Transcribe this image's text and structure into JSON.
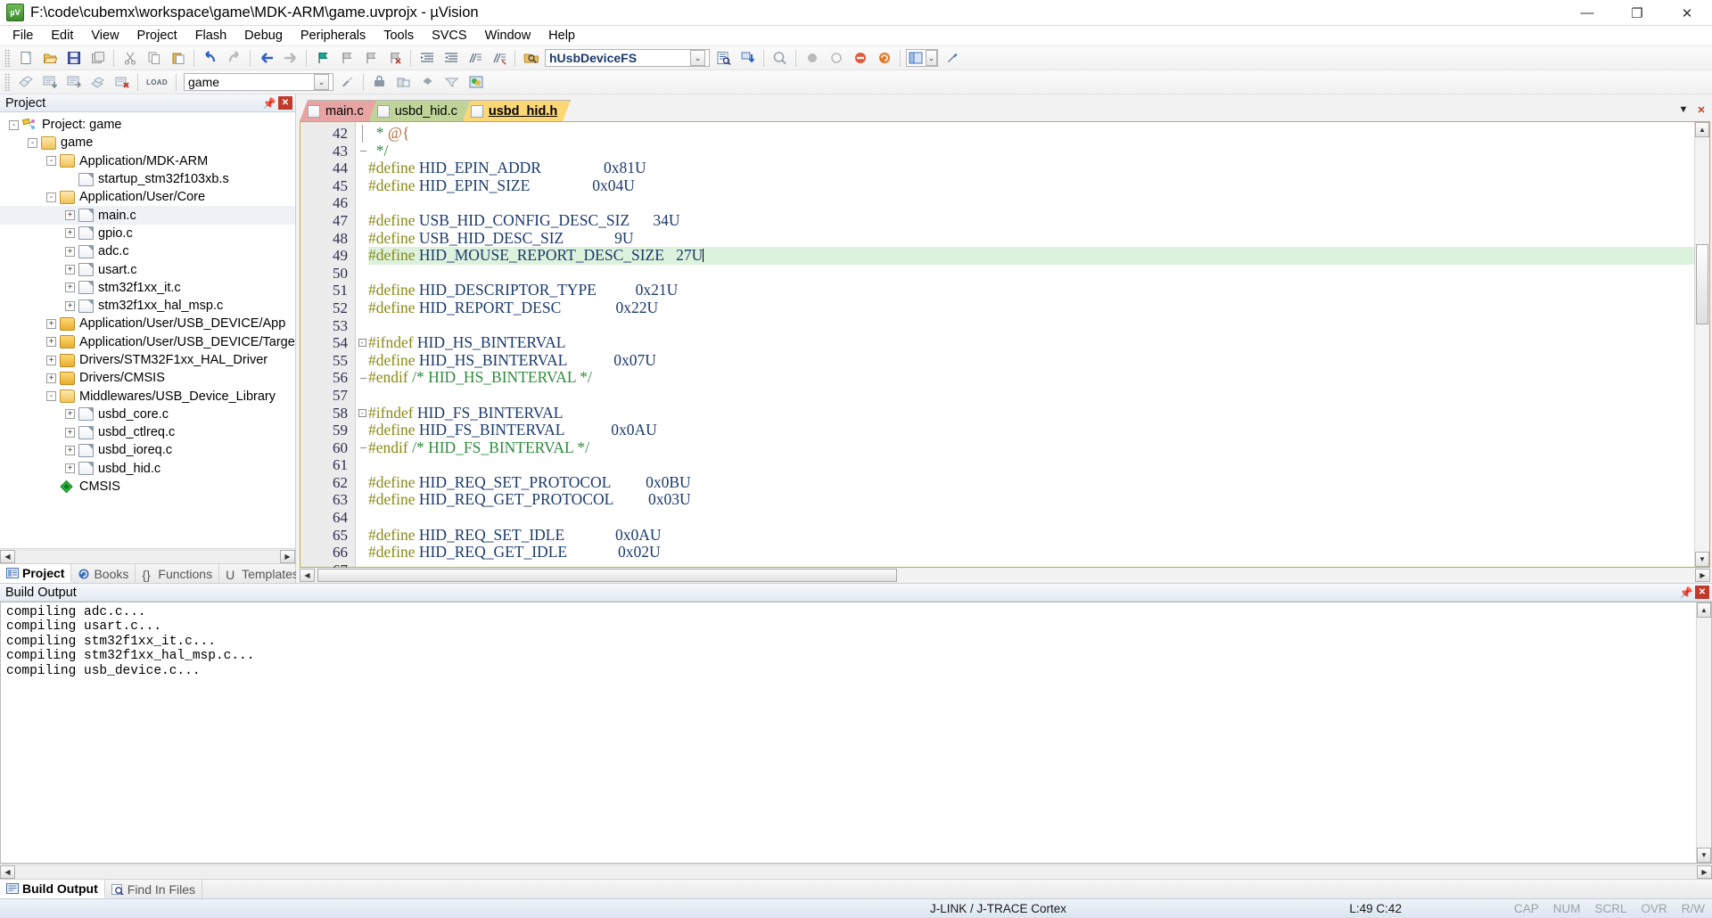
{
  "window": {
    "title": "F:\\code\\cubemx\\workspace\\game\\MDK-ARM\\game.uvprojx - µVision",
    "app_icon": "uvision-icon",
    "minimize": "—",
    "maximize": "❐",
    "close": "✕"
  },
  "menu": [
    "File",
    "Edit",
    "View",
    "Project",
    "Flash",
    "Debug",
    "Peripherals",
    "Tools",
    "SVCS",
    "Window",
    "Help"
  ],
  "toolbar1": {
    "icons": [
      "new-file-icon",
      "open-file-icon",
      "save-icon",
      "save-all-icon",
      "cut-icon",
      "copy-icon",
      "paste-icon",
      "undo-icon",
      "redo-icon",
      "back-icon",
      "forward-icon",
      "bookmark-toggle-icon",
      "bookmark-prev-icon",
      "bookmark-next-icon",
      "bookmark-clear-icon",
      "indent-icon",
      "outdent-icon",
      "comment-icon",
      "uncomment-icon"
    ],
    "symbol_icon": "find-symbol-icon",
    "symbol_value": "hUsbDeviceFS",
    "symbol_placeholder": "",
    "caret": "⌄",
    "after_icons": [
      "browse-info-icon",
      "insert-symbol-icon",
      "magnifier-icon",
      "start-debug-icon",
      "stop-debug-icon",
      "no-entry-icon",
      "reset-icon",
      "window-layout-icon",
      "configure-icon"
    ]
  },
  "toolbar2": {
    "icons": [
      "translate-icon",
      "build-icon",
      "rebuild-icon",
      "batch-build-icon",
      "stop-build-icon",
      "load-icon"
    ],
    "load_label": "LOAD",
    "target_icon": "target-select-icon",
    "target_value": "game",
    "caret": "⌄",
    "after_icons": [
      "target-options-icon",
      "manage-runtime-icon",
      "books-icon",
      "multi-project-icon",
      "pack-installer-icon"
    ]
  },
  "project_pane": {
    "header": "Project",
    "pin_icon": "pin-icon",
    "close_icon": "close-icon",
    "tree": [
      {
        "depth": 0,
        "expander": "-",
        "icon": "project-icon",
        "label": "Project: game",
        "selected": false
      },
      {
        "depth": 1,
        "expander": "-",
        "icon": "target-folder-icon",
        "label": "game",
        "selected": false
      },
      {
        "depth": 2,
        "expander": "-",
        "icon": "folder-open-icon",
        "label": "Application/MDK-ARM",
        "selected": false
      },
      {
        "depth": 3,
        "expander": "",
        "icon": "file-icon",
        "label": "startup_stm32f103xb.s",
        "selected": false
      },
      {
        "depth": 2,
        "expander": "-",
        "icon": "folder-open-icon",
        "label": "Application/User/Core",
        "selected": false
      },
      {
        "depth": 3,
        "expander": "+",
        "icon": "file-icon",
        "label": "main.c",
        "selected": true
      },
      {
        "depth": 3,
        "expander": "+",
        "icon": "file-icon",
        "label": "gpio.c",
        "selected": false
      },
      {
        "depth": 3,
        "expander": "+",
        "icon": "file-icon",
        "label": "adc.c",
        "selected": false
      },
      {
        "depth": 3,
        "expander": "+",
        "icon": "file-icon",
        "label": "usart.c",
        "selected": false
      },
      {
        "depth": 3,
        "expander": "+",
        "icon": "file-icon",
        "label": "stm32f1xx_it.c",
        "selected": false
      },
      {
        "depth": 3,
        "expander": "+",
        "icon": "file-icon",
        "label": "stm32f1xx_hal_msp.c",
        "selected": false
      },
      {
        "depth": 2,
        "expander": "+",
        "icon": "folder-icon",
        "label": "Application/User/USB_DEVICE/App",
        "selected": false
      },
      {
        "depth": 2,
        "expander": "+",
        "icon": "folder-icon",
        "label": "Application/User/USB_DEVICE/Target",
        "selected": false
      },
      {
        "depth": 2,
        "expander": "+",
        "icon": "folder-icon",
        "label": "Drivers/STM32F1xx_HAL_Driver",
        "selected": false
      },
      {
        "depth": 2,
        "expander": "+",
        "icon": "folder-icon",
        "label": "Drivers/CMSIS",
        "selected": false
      },
      {
        "depth": 2,
        "expander": "-",
        "icon": "folder-open-icon",
        "label": "Middlewares/USB_Device_Library",
        "selected": false
      },
      {
        "depth": 3,
        "expander": "+",
        "icon": "file-icon",
        "label": "usbd_core.c",
        "selected": false
      },
      {
        "depth": 3,
        "expander": "+",
        "icon": "file-icon",
        "label": "usbd_ctlreq.c",
        "selected": false
      },
      {
        "depth": 3,
        "expander": "+",
        "icon": "file-icon",
        "label": "usbd_ioreq.c",
        "selected": false
      },
      {
        "depth": 3,
        "expander": "+",
        "icon": "file-icon",
        "label": "usbd_hid.c",
        "selected": false
      },
      {
        "depth": 2,
        "expander": "",
        "icon": "cmsis-icon",
        "label": "CMSIS",
        "selected": false
      }
    ],
    "scroll_left": "◀",
    "scroll_right": "▶",
    "tabs": [
      {
        "label": "Project",
        "icon": "project-tab-icon",
        "active": true
      },
      {
        "label": "Books",
        "icon": "books-tab-icon",
        "active": false
      },
      {
        "label": "Functions",
        "icon": "functions-tab-icon",
        "active": false
      },
      {
        "label": "Templates",
        "icon": "templates-tab-icon",
        "active": false
      }
    ]
  },
  "editor": {
    "tabs": [
      {
        "label": "main.c",
        "color": "#e8a3a3",
        "active": false
      },
      {
        "label": "usbd_hid.c",
        "color": "#c0d49a",
        "active": false
      },
      {
        "label": "usbd_hid.h",
        "color": "#fcd775",
        "active": true
      }
    ],
    "tab_prev": "◀",
    "tab_next": "▶",
    "tab_close": "✕",
    "first_line": 42,
    "highlight_line": 49,
    "lines": [
      {
        "n": 42,
        "fold": "line",
        "tokens": [
          {
            "t": "  * ",
            "c": "cmt"
          },
          {
            "t": "@{",
            "c": "at"
          }
        ]
      },
      {
        "n": 43,
        "fold": "end",
        "tokens": [
          {
            "t": "  */",
            "c": "cmt"
          }
        ]
      },
      {
        "n": 44,
        "fold": "",
        "tokens": [
          {
            "t": "#define",
            "c": "kw"
          },
          {
            "t": " HID_EPIN_ADDR                ",
            "c": "id"
          },
          {
            "t": "0x81U",
            "c": "num"
          }
        ]
      },
      {
        "n": 45,
        "fold": "",
        "tokens": [
          {
            "t": "#define",
            "c": "kw"
          },
          {
            "t": " HID_EPIN_SIZE                ",
            "c": "id"
          },
          {
            "t": "0x04U",
            "c": "num"
          }
        ]
      },
      {
        "n": 46,
        "fold": "",
        "tokens": []
      },
      {
        "n": 47,
        "fold": "",
        "tokens": [
          {
            "t": "#define",
            "c": "kw"
          },
          {
            "t": " USB_HID_CONFIG_DESC_SIZ      ",
            "c": "id"
          },
          {
            "t": "34U",
            "c": "num"
          }
        ]
      },
      {
        "n": 48,
        "fold": "",
        "tokens": [
          {
            "t": "#define",
            "c": "kw"
          },
          {
            "t": " USB_HID_DESC_SIZ             ",
            "c": "id"
          },
          {
            "t": "9U",
            "c": "num"
          }
        ]
      },
      {
        "n": 49,
        "fold": "",
        "tokens": [
          {
            "t": "#define",
            "c": "kw"
          },
          {
            "t": " HID_MOUSE_REPORT_DESC_SIZE   ",
            "c": "id"
          },
          {
            "t": "27U",
            "c": "num"
          }
        ],
        "caret": true
      },
      {
        "n": 50,
        "fold": "",
        "tokens": []
      },
      {
        "n": 51,
        "fold": "",
        "tokens": [
          {
            "t": "#define",
            "c": "kw"
          },
          {
            "t": " HID_DESCRIPTOR_TYPE          ",
            "c": "id"
          },
          {
            "t": "0x21U",
            "c": "num"
          }
        ]
      },
      {
        "n": 52,
        "fold": "",
        "tokens": [
          {
            "t": "#define",
            "c": "kw"
          },
          {
            "t": " HID_REPORT_DESC              ",
            "c": "id"
          },
          {
            "t": "0x22U",
            "c": "num"
          }
        ]
      },
      {
        "n": 53,
        "fold": "",
        "tokens": []
      },
      {
        "n": 54,
        "fold": "start",
        "tokens": [
          {
            "t": "#ifndef",
            "c": "kw"
          },
          {
            "t": " HID_HS_BINTERVAL",
            "c": "id"
          }
        ]
      },
      {
        "n": 55,
        "fold": "",
        "tokens": [
          {
            "t": "#define",
            "c": "kw"
          },
          {
            "t": " HID_HS_BINTERVAL            ",
            "c": "id"
          },
          {
            "t": "0x07U",
            "c": "num"
          }
        ]
      },
      {
        "n": 56,
        "fold": "endif",
        "tokens": [
          {
            "t": "#endif",
            "c": "kw"
          },
          {
            "t": " ",
            "c": "id"
          },
          {
            "t": "/* HID_HS_BINTERVAL */",
            "c": "cmt"
          }
        ]
      },
      {
        "n": 57,
        "fold": "",
        "tokens": []
      },
      {
        "n": 58,
        "fold": "start",
        "tokens": [
          {
            "t": "#ifndef",
            "c": "kw"
          },
          {
            "t": " HID_FS_BINTERVAL",
            "c": "id"
          }
        ]
      },
      {
        "n": 59,
        "fold": "",
        "tokens": [
          {
            "t": "#define",
            "c": "kw"
          },
          {
            "t": " HID_FS_BINTERVAL            ",
            "c": "id"
          },
          {
            "t": "0x0AU",
            "c": "num"
          }
        ]
      },
      {
        "n": 60,
        "fold": "endif",
        "tokens": [
          {
            "t": "#endif",
            "c": "kw"
          },
          {
            "t": " ",
            "c": "id"
          },
          {
            "t": "/* HID_FS_BINTERVAL */",
            "c": "cmt"
          }
        ]
      },
      {
        "n": 61,
        "fold": "",
        "tokens": []
      },
      {
        "n": 62,
        "fold": "",
        "tokens": [
          {
            "t": "#define",
            "c": "kw"
          },
          {
            "t": " HID_REQ_SET_PROTOCOL         ",
            "c": "id"
          },
          {
            "t": "0x0BU",
            "c": "num"
          }
        ]
      },
      {
        "n": 63,
        "fold": "",
        "tokens": [
          {
            "t": "#define",
            "c": "kw"
          },
          {
            "t": " HID_REQ_GET_PROTOCOL         ",
            "c": "id"
          },
          {
            "t": "0x03U",
            "c": "num"
          }
        ]
      },
      {
        "n": 64,
        "fold": "",
        "tokens": []
      },
      {
        "n": 65,
        "fold": "",
        "tokens": [
          {
            "t": "#define",
            "c": "kw"
          },
          {
            "t": " HID_REQ_SET_IDLE             ",
            "c": "id"
          },
          {
            "t": "0x0AU",
            "c": "num"
          }
        ]
      },
      {
        "n": 66,
        "fold": "",
        "tokens": [
          {
            "t": "#define",
            "c": "kw"
          },
          {
            "t": " HID_REQ_GET_IDLE             ",
            "c": "id"
          },
          {
            "t": "0x02U",
            "c": "num"
          }
        ]
      },
      {
        "n": 67,
        "fold": "",
        "tokens": []
      }
    ]
  },
  "build_output": {
    "header": "Build Output",
    "pin_icon": "pin-icon",
    "close_icon": "close-icon",
    "lines": [
      "compiling adc.c...",
      "compiling usart.c...",
      "compiling stm32f1xx_it.c...",
      "compiling stm32f1xx_hal_msp.c...",
      "compiling usb_device.c..."
    ]
  },
  "bottom_tabs": [
    {
      "label": "Build Output",
      "icon": "build-output-icon",
      "active": true
    },
    {
      "label": "Find In Files",
      "icon": "find-in-files-icon",
      "active": false
    }
  ],
  "statusbar": {
    "debugger": "J-LINK / J-TRACE Cortex",
    "position": "L:49 C:42",
    "indicators": [
      "CAP",
      "NUM",
      "SCRL",
      "OVR",
      "R/W"
    ]
  },
  "colors": {
    "accent": "#1b3a6b",
    "keyword": "#8a8a12",
    "comment": "#2e8b3d",
    "highlight": "#ddf2dd",
    "tab_active": "#fcd775"
  }
}
